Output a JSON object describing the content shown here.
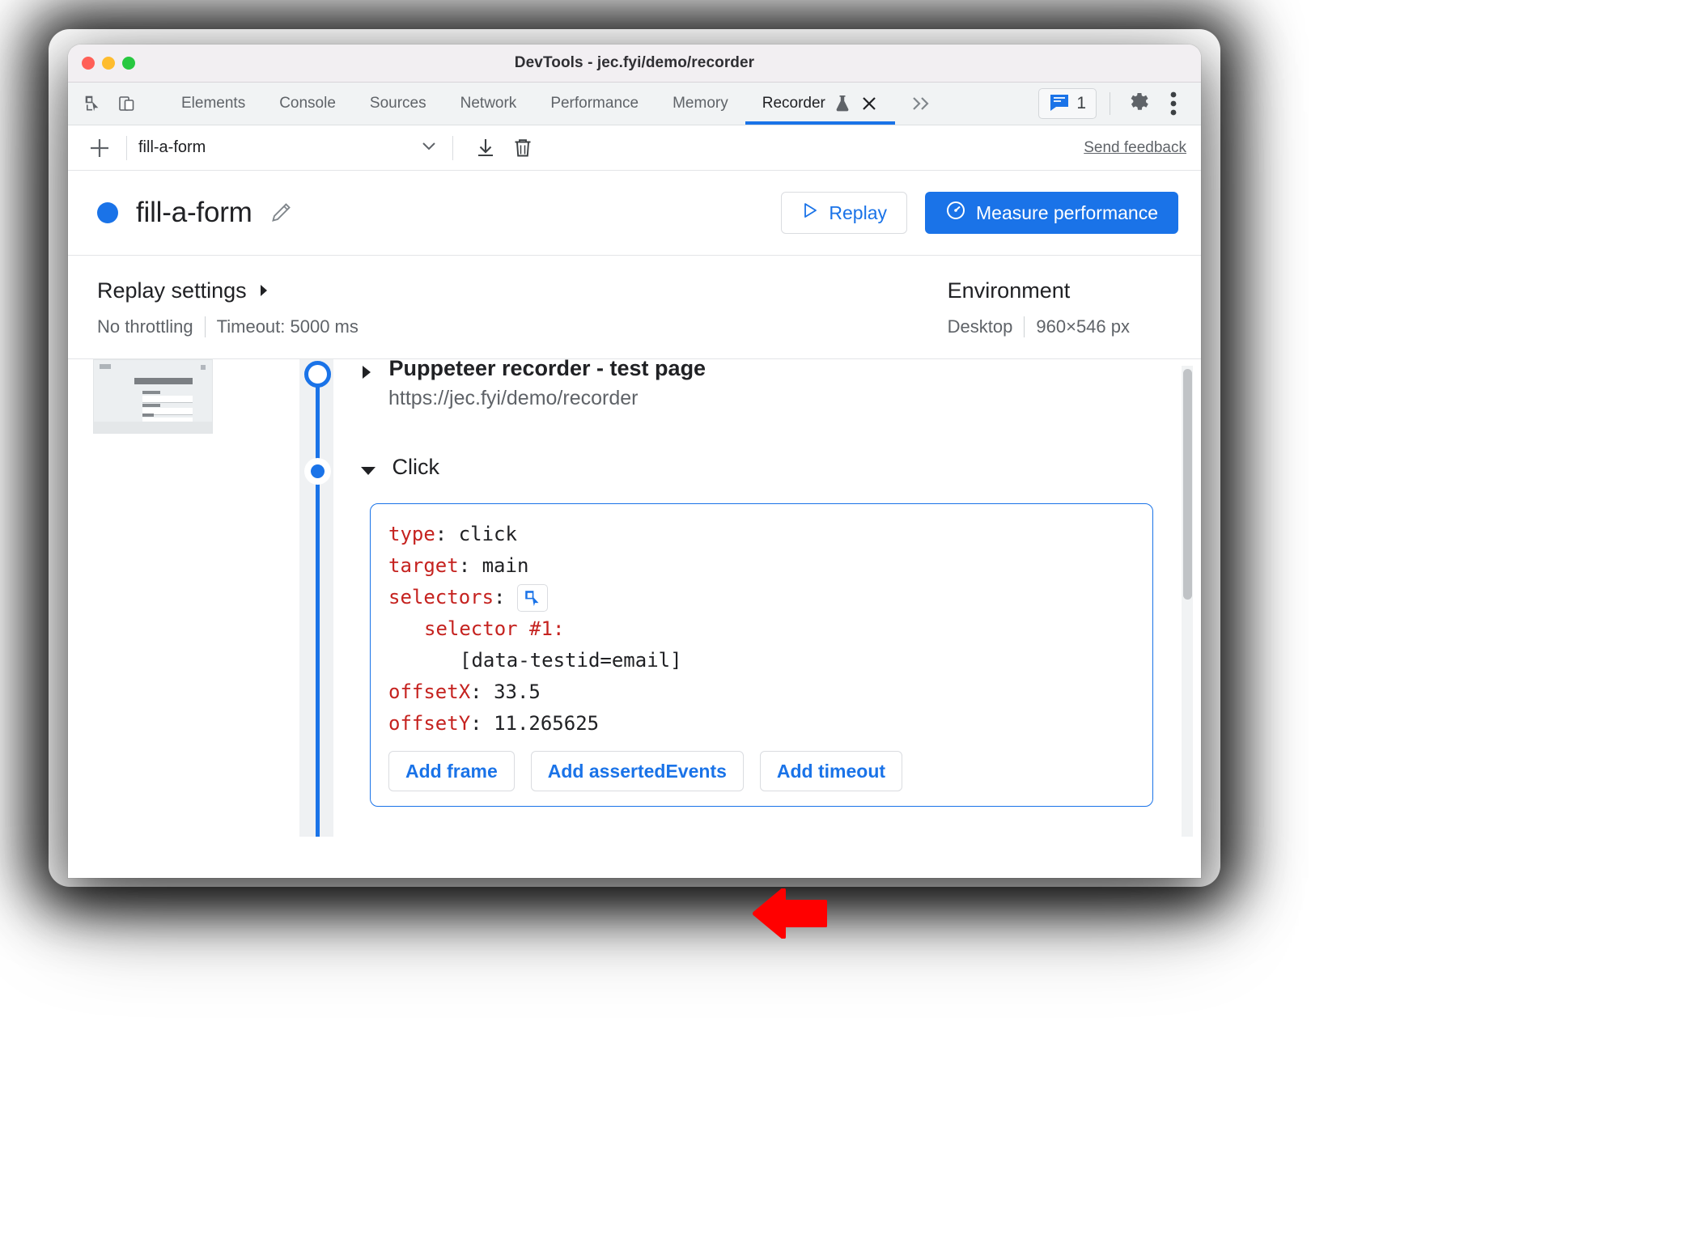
{
  "window": {
    "title": "DevTools - jec.fyi/demo/recorder",
    "traffic_lights": [
      "close",
      "minimize",
      "zoom"
    ]
  },
  "tabbar": {
    "icons": [
      {
        "name": "inspect-element-icon"
      },
      {
        "name": "device-toolbar-icon"
      }
    ],
    "tabs": [
      {
        "label": "Elements",
        "active": false
      },
      {
        "label": "Console",
        "active": false
      },
      {
        "label": "Sources",
        "active": false
      },
      {
        "label": "Network",
        "active": false
      },
      {
        "label": "Performance",
        "active": false
      },
      {
        "label": "Memory",
        "active": false
      },
      {
        "label": "Recorder",
        "active": true,
        "experiment_icon": "flask-icon",
        "close_icon": "close-icon"
      }
    ],
    "more_tabs_label": "»",
    "issues": {
      "icon": "issues-message-icon",
      "count": "1"
    },
    "settings_icon": "gear-icon",
    "more_icon": "kebab-menu-icon"
  },
  "recorder_toolbar": {
    "add_icon": "plus-icon",
    "selected_recording": "fill-a-form",
    "dropdown_icon": "chevron-down-icon",
    "export_icon": "download-icon",
    "delete_icon": "trash-icon",
    "feedback_label": "Send feedback"
  },
  "title_row": {
    "status_dot_color": "#1a73e8",
    "recording_name": "fill-a-form",
    "edit_icon": "pencil-icon",
    "replay_button": {
      "label": "Replay",
      "icon": "play-triangle-icon"
    },
    "measure_button": {
      "label": "Measure performance",
      "icon": "performance-gauge-icon"
    }
  },
  "settings": {
    "replay": {
      "title": "Replay settings",
      "expand_icon": "caret-right-icon",
      "throttling": "No throttling",
      "timeout": "Timeout: 5000 ms"
    },
    "environment": {
      "title": "Environment",
      "device": "Desktop",
      "viewport": "960×546 px"
    }
  },
  "steps": [
    {
      "kind": "navigate",
      "caret": "collapsed",
      "title": "Puppeteer recorder - test page",
      "url": "https://jec.fyi/demo/recorder",
      "menu_icon": "kebab-menu-icon",
      "thumbnail": "page-screenshot-thumbnail"
    },
    {
      "kind": "click",
      "caret": "expanded",
      "title": "Click",
      "menu_icon": "kebab-menu-icon",
      "code": [
        {
          "key": "type",
          "value": "click",
          "indent": 0
        },
        {
          "key": "target",
          "value": "main",
          "indent": 0
        },
        {
          "key": "selectors",
          "value": "",
          "indent": 0,
          "picker_icon": "select-element-icon"
        },
        {
          "key": "selector #1",
          "value": "",
          "indent": 1
        },
        {
          "key": "",
          "value": "[data-testid=email]",
          "indent": 2,
          "annotated": true
        },
        {
          "key": "offsetX",
          "value": "33.5",
          "indent": 0
        },
        {
          "key": "offsetY",
          "value": "11.265625",
          "indent": 0
        }
      ],
      "buttons": [
        "Add frame",
        "Add assertedEvents",
        "Add timeout"
      ]
    }
  ],
  "annotation": {
    "arrow_color": "#ff0000",
    "points_to": "[data-testid=email]"
  },
  "colors": {
    "accent": "#1a73e8",
    "code_key": "#c5221f",
    "titlebar": "#f2eff2",
    "tabbar": "#f1f3f4",
    "rail": "#eff1f3"
  }
}
